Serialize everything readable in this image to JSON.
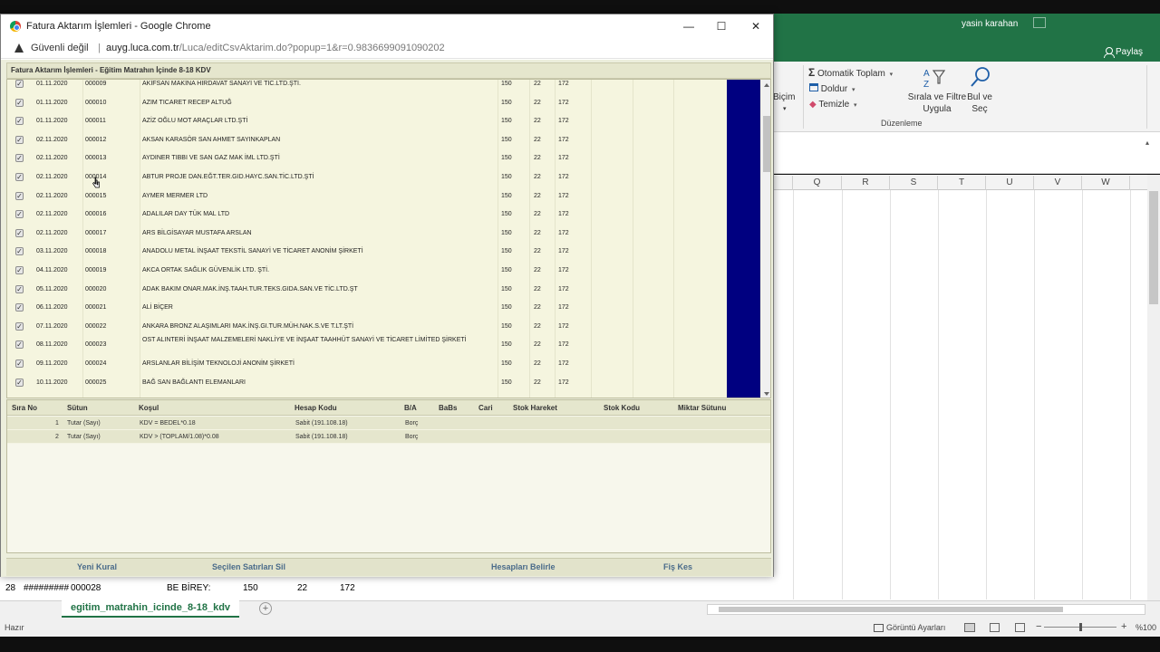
{
  "excel": {
    "user_name": "yasin karahan",
    "share_label": "Paylaş",
    "ribbon": {
      "format_label": "Biçim",
      "autosum_label": "Otomatik Toplam",
      "fill_label": "Doldur",
      "clear_label": "Temizle",
      "sort_filter_label": "Sırala ve Filtre Uygula",
      "find_select_label": "Bul ve Seç",
      "group_label": "Düzenleme"
    },
    "columns": [
      "Q",
      "R",
      "S",
      "T",
      "U",
      "V",
      "W"
    ],
    "visible_row": {
      "row_number": "28",
      "date": "#########",
      "doc_no": "000028",
      "name": "BE BİREY:",
      "account": "150",
      "vat_rate": "22",
      "vat_account": "172"
    },
    "sheet_tab": "egitim_matrahin_icinde_8-18_kdv",
    "add_sheet": "+",
    "status_ready": "Hazır",
    "display_settings": "Görüntü Ayarları",
    "zoom_level": "%100",
    "zoom_minus": "−",
    "zoom_plus": "+"
  },
  "popup": {
    "window_title": "Fatura Aktarım İşlemleri - Google Chrome",
    "minimize": "—",
    "maximize": "☐",
    "close": "✕",
    "not_secure": "Güvenli değil",
    "url_host": "auyg.luca.com.tr",
    "url_path": "/Luca/editCsvAktarim.do?popup=1&r=0.9836699091090202",
    "header": "Fatura Aktarım İşlemleri - Eğitim Matrahın İçinde 8-18 KDV",
    "invoices": [
      {
        "date": "01.11.2020",
        "no": "000009",
        "name": "AKİFSAN MAKİNA HIRDAVAT SANAYİ VE TİC.LTD.ŞTİ.",
        "acct": "150",
        "rate": "22",
        "vat": "172"
      },
      {
        "date": "01.11.2020",
        "no": "000010",
        "name": "AZIM TICARET RECEP ALTUĞ",
        "acct": "150",
        "rate": "22",
        "vat": "172"
      },
      {
        "date": "01.11.2020",
        "no": "000011",
        "name": "AZİZ OĞLU MOT ARAÇLAR LTD.ŞTİ",
        "acct": "150",
        "rate": "22",
        "vat": "172"
      },
      {
        "date": "02.11.2020",
        "no": "000012",
        "name": "AKSAN KARASÖR SAN AHMET SAYINKAPLAN",
        "acct": "150",
        "rate": "22",
        "vat": "172"
      },
      {
        "date": "02.11.2020",
        "no": "000013",
        "name": "AYDINER TIBBI VE SAN GAZ MAK İML LTD.ŞTİ",
        "acct": "150",
        "rate": "22",
        "vat": "172"
      },
      {
        "date": "02.11.2020",
        "no": "000014",
        "name": "ABTUR PROJE DAN.EĞT.TER.GID.HAYC.SAN.TİC.LTD.ŞTİ",
        "acct": "150",
        "rate": "22",
        "vat": "172"
      },
      {
        "date": "02.11.2020",
        "no": "000015",
        "name": "AYMER MERMER LTD",
        "acct": "150",
        "rate": "22",
        "vat": "172"
      },
      {
        "date": "02.11.2020",
        "no": "000016",
        "name": "ADALILAR DAY TÜK MAL LTD",
        "acct": "150",
        "rate": "22",
        "vat": "172"
      },
      {
        "date": "02.11.2020",
        "no": "000017",
        "name": "ARS BİLGİSAYAR MUSTAFA ARSLAN",
        "acct": "150",
        "rate": "22",
        "vat": "172"
      },
      {
        "date": "03.11.2020",
        "no": "000018",
        "name": "ANADOLU METAL İNŞAAT TEKSTİL SANAYİ VE TİCARET ANONİM ŞİRKETİ",
        "acct": "150",
        "rate": "22",
        "vat": "172"
      },
      {
        "date": "04.11.2020",
        "no": "000019",
        "name": "AKCA ORTAK SAĞLIK GÜVENLİK LTD. ŞTİ.",
        "acct": "150",
        "rate": "22",
        "vat": "172"
      },
      {
        "date": "05.11.2020",
        "no": "000020",
        "name": "ADAK BAKIM ONAR.MAK.İNŞ.TAAH.TUR.TEKS.GIDA.SAN.VE TİC.LTD.ŞT",
        "acct": "150",
        "rate": "22",
        "vat": "172"
      },
      {
        "date": "06.11.2020",
        "no": "000021",
        "name": "ALİ BİÇER",
        "acct": "150",
        "rate": "22",
        "vat": "172"
      },
      {
        "date": "07.11.2020",
        "no": "000022",
        "name": "ANKARA BRONZ ALAŞIMLARI MAK.İNŞ.GI.TUR.MÜH.NAK.S.VE T.LT.ŞTİ",
        "acct": "150",
        "rate": "22",
        "vat": "172"
      },
      {
        "date": "08.11.2020",
        "no": "000023",
        "name": "OST ALINTERİ İNŞAAT MALZEMELERİ NAKLİYE VE İNŞAAT TAAHHÜT SANAYİ VE TİCARET LİMİTED ŞİRKETİ",
        "acct": "150",
        "rate": "22",
        "vat": "172"
      },
      {
        "date": "09.11.2020",
        "no": "000024",
        "name": "ARSLANLAR BİLİŞİM TEKNOLOJİ ANONİM ŞİRKETİ",
        "acct": "150",
        "rate": "22",
        "vat": "172"
      },
      {
        "date": "10.11.2020",
        "no": "000025",
        "name": "BAĞ SAN BAĞLANTI ELEMANLARI",
        "acct": "150",
        "rate": "22",
        "vat": "172"
      }
    ],
    "rules_header": {
      "no": "Sıra No",
      "column": "Sütun",
      "condition": "Koşul",
      "account": "Hesap Kodu",
      "ba": "B/A",
      "babs": "BaBs",
      "cari": "Cari",
      "stock_movement": "Stok Hareket",
      "stock_code": "Stok Kodu",
      "qty_column": "Miktar Sütunu"
    },
    "rules": [
      {
        "no": "1",
        "column": "Tutar (Sayı)",
        "condition": "KDV = BEDEL*0.18",
        "account": "Sabit (191.108.18)",
        "ba": "Borç"
      },
      {
        "no": "2",
        "column": "Tutar (Sayı)",
        "condition": "KDV > (TOPLAM/1.08)*0.08",
        "account": "Sabit (191.108.18)",
        "ba": "Borç"
      }
    ],
    "buttons": {
      "new_rule": "Yeni Kural",
      "delete_selected": "Seçilen Satırları Sil",
      "determine_accounts": "Hesapları Belirle",
      "create_voucher": "Fiş Kes"
    }
  }
}
